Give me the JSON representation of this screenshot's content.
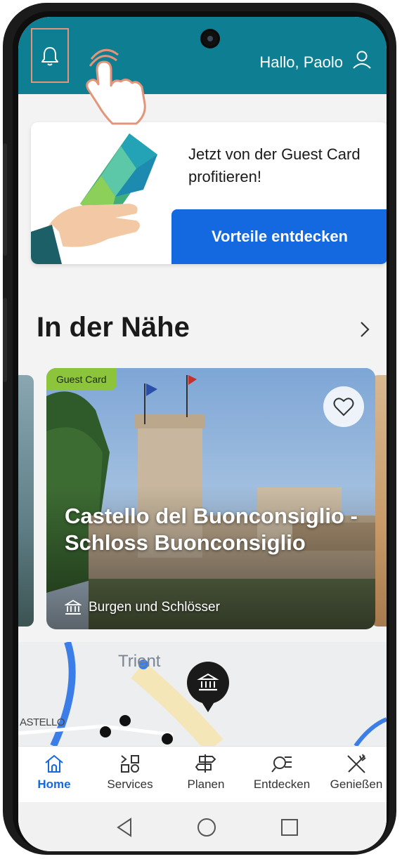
{
  "header": {
    "greeting": "Hallo, Paolo",
    "icons": {
      "notifications": "bell-icon",
      "profile": "user-icon",
      "tap_hint": "pointing-hand-icon"
    },
    "colors": {
      "bar": "#0e7e92",
      "highlight": "#e2957a"
    }
  },
  "promo": {
    "text": "Jetzt von der Guest Card profitieren!",
    "button_label": "Vorteile entdecken",
    "button_color": "#1569e0"
  },
  "nearby": {
    "title": "In der Nähe",
    "card": {
      "badge": "Guest Card",
      "title": "Castello del Buonconsiglio - Schloss Buonconsiglio",
      "category": "Burgen und Schlösser",
      "badge_color": "#8cc43c"
    }
  },
  "map": {
    "city_label": "Trient",
    "area_label": "ASTELLO"
  },
  "bottom_nav": {
    "items": [
      {
        "label": "Home",
        "icon": "home-icon",
        "active": true
      },
      {
        "label": "Services",
        "icon": "services-grid-icon",
        "active": false
      },
      {
        "label": "Planen",
        "icon": "signpost-icon",
        "active": false
      },
      {
        "label": "Entdecken",
        "icon": "search-list-icon",
        "active": false
      },
      {
        "label": "Genießen",
        "icon": "fork-knife-icon",
        "active": false
      }
    ],
    "active_color": "#1569e0"
  },
  "system_nav": {
    "back": "back-triangle-icon",
    "home": "home-circle-icon",
    "recents": "recents-square-icon"
  }
}
